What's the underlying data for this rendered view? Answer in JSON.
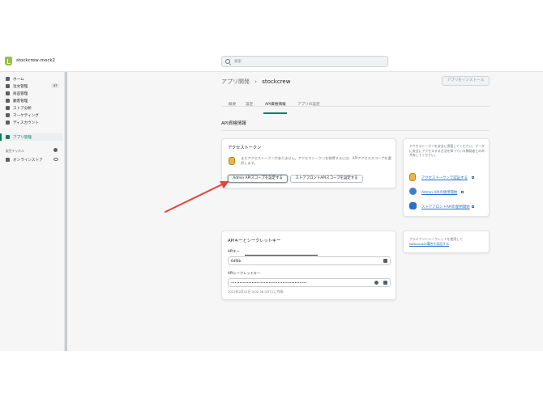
{
  "topbar": {
    "store_name": "stockcrew-mock2",
    "search_placeholder": "検索"
  },
  "sidebar": {
    "items": [
      {
        "label": "ホーム",
        "icon": "home-icon"
      },
      {
        "label": "注文管理",
        "icon": "orders-icon",
        "badge": "47"
      },
      {
        "label": "商品管理",
        "icon": "tag-icon"
      },
      {
        "label": "顧客管理",
        "icon": "person-icon"
      },
      {
        "label": "ストア分析",
        "icon": "analytics-icon"
      },
      {
        "label": "マーケティング",
        "icon": "marketing-icon"
      },
      {
        "label": "ディスカウント",
        "icon": "discount-icon"
      },
      {
        "label": "アプリ管理",
        "icon": "apps-icon",
        "active": true
      }
    ],
    "sales_channels_heading": "販売チャネル",
    "online_store_label": "オンラインストア"
  },
  "page": {
    "breadcrumb": "アプリ開発",
    "separator": "›",
    "title": "stockcrew",
    "install_button": "アプリをインストール"
  },
  "tabs": [
    {
      "label": "概要"
    },
    {
      "label": "設定"
    },
    {
      "label": "API資格情報",
      "active": true
    },
    {
      "label": "アプリの設定"
    }
  ],
  "section_title": "API資格情報",
  "access_token_card": {
    "title": "アクセストークン",
    "description": "まだアクセストークンがありません。アクセストークンを取得するには、APIアクセススコープを選択します。",
    "admin_button": "Admin APIスコープを設定する",
    "storefront_button": "ストアフロントAPIスコープを設定する"
  },
  "access_token_help": {
    "text": "アクセストークンを安全に保管してください。データに安全にアクセスする方法を知っている開発者とのみ共有してください。",
    "links": [
      {
        "label": "アクセストークンで認証する",
        "icon": "token-icon"
      },
      {
        "label": "Admin APIの使用開始",
        "icon": "gear-icon"
      },
      {
        "label": "ストアフロントAPIの使用開始",
        "icon": "storefront-icon"
      }
    ]
  },
  "api_key_card": {
    "title": "APIキーとシークレットキー",
    "api_key_label": "APIキー",
    "api_key_value": "6df6b",
    "secret_label": "APIシークレットキー",
    "secret_value": "••••••••••••••••••••••••••••••••••••••••••••",
    "created_at": "2022年2月14日 0:02:38 (UTC) に作成"
  },
  "api_key_help": {
    "text": "クライアントシークレットを使用して",
    "link": "Webhookの署名を認証する"
  },
  "colors": {
    "accent": "#008060",
    "link": "#2c6ecb",
    "arrow": "#e0463b",
    "logo": "#95bf47"
  }
}
